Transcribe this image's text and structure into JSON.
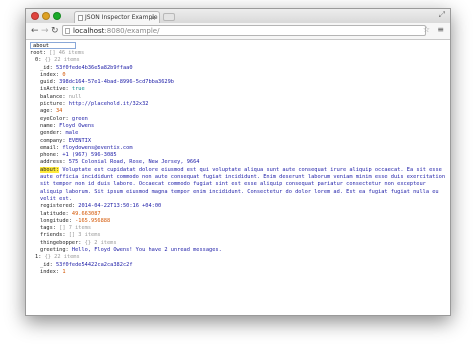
{
  "browser": {
    "tab_title": "JSON Inspector Example",
    "url_host": "localhost",
    "url_port_path": ":8080/example/"
  },
  "search": {
    "value": "about"
  },
  "tree": {
    "root_key": "root:",
    "root_meta": "[] 46 items",
    "item0_key": "0:",
    "item0_meta": "{} 22 items",
    "item0": [
      {
        "k": "_id:",
        "v": "53f0fede4b36e5a82b9ffaa0",
        "t": "str"
      },
      {
        "k": "index:",
        "v": "0",
        "t": "num"
      },
      {
        "k": "guid:",
        "v": "398dc164-57e1-4bad-8996-5cd7bba3629b",
        "t": "str"
      },
      {
        "k": "isActive:",
        "v": "true",
        "t": "bool"
      },
      {
        "k": "balance:",
        "v": "null",
        "t": "nul"
      },
      {
        "k": "picture:",
        "v": "http://placehold.it/32x32",
        "t": "str"
      },
      {
        "k": "age:",
        "v": "34",
        "t": "num"
      },
      {
        "k": "eyeColor:",
        "v": "green",
        "t": "str"
      },
      {
        "k": "name:",
        "v": "Floyd Owens",
        "t": "str"
      },
      {
        "k": "gender:",
        "v": "male",
        "t": "str"
      },
      {
        "k": "company:",
        "v": "EVENTIX",
        "t": "str"
      },
      {
        "k": "email:",
        "v": "floydowens@eventix.com",
        "t": "str"
      },
      {
        "k": "phone:",
        "v": "+1 (967) 596-3085",
        "t": "str"
      },
      {
        "k": "address:",
        "v": "575 Colonial Road, Rose, New Jersey, 9664",
        "t": "str"
      }
    ],
    "about_key": "about:",
    "about_value": "Voluptate est cupidatat dolore eiusmod est qui voluptate aliqua sunt aute consequat irure aliquip occaecat. Ea sit esse aute officia incididunt commodo non aute consequat fugiat incididunt. Enim deserunt laborum veniam minim esse duis exercitation sit tempor non id duis labore. Occaecat commodo fugiat sint est esse aliquip consequat pariatur consectetur non excepteur aliquip laborum. Sit ipsum eiusmod magna tempor enim incididunt. Consectetur do dolor lorem ad. Est ea fugiat fugiat nulla eu velit est.",
    "item0_rest": [
      {
        "k": "registered:",
        "v": "2014-04-22T13:50:16 +04:00",
        "t": "str"
      },
      {
        "k": "latitude:",
        "v": "49.663087",
        "t": "num"
      },
      {
        "k": "longitude:",
        "v": "-165.956888",
        "t": "num"
      },
      {
        "k": "tags:",
        "v": "[] 7 items",
        "t": "meta"
      },
      {
        "k": "friends:",
        "v": "[] 3 items",
        "t": "meta"
      },
      {
        "k": "thingebopper:",
        "v": "{} 2 items",
        "t": "meta"
      },
      {
        "k": "greeting:",
        "v": "Hello, Floyd Owens! You have 2 unread messages.",
        "t": "str"
      }
    ],
    "item1_key": "1:",
    "item1_meta": "{} 22 items",
    "item1": [
      {
        "k": "_id:",
        "v": "53f0fede54422ca2ca382c2f",
        "t": "str"
      },
      {
        "k": "index:",
        "v": "1",
        "t": "num"
      }
    ]
  }
}
